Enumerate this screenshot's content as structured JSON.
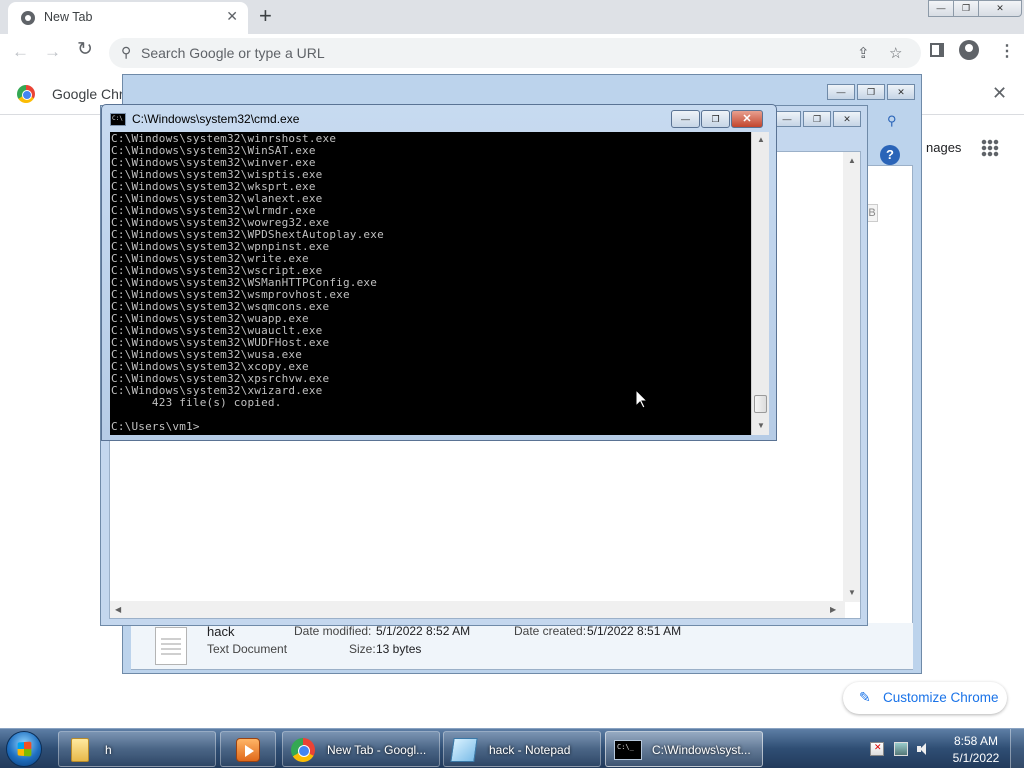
{
  "chrome": {
    "tab_title": "New Tab",
    "tab_close": "✕",
    "new_tab": "+",
    "omnibox_placeholder": "Search Google or type a URL",
    "back": "←",
    "forward": "→",
    "reload": "↻",
    "share": "⇪",
    "bookmark": "☆",
    "menu": "⋮",
    "infobar_text": "Google Chro",
    "infobar_close": "✕",
    "images_link": "nages",
    "customize_label": "Customize Chrome",
    "window_controls": {
      "minimize": "—",
      "maximize": "❐",
      "close": "✕"
    }
  },
  "explorer": {
    "file_name": "hack",
    "file_type": "Text Document",
    "date_modified_label": "Date modified:",
    "date_modified_value": "5/1/2022 8:52 AM",
    "date_created_label": "Date created:",
    "date_created_value": "5/1/2022 8:51 AM",
    "size_label": "Size:",
    "size_value": "13 bytes",
    "help": "?",
    "partial_label": "B"
  },
  "cmd": {
    "title": "C:\\Windows\\system32\\cmd.exe",
    "lines": [
      "C:\\Windows\\system32\\winrshost.exe",
      "C:\\Windows\\system32\\WinSAT.exe",
      "C:\\Windows\\system32\\winver.exe",
      "C:\\Windows\\system32\\wisptis.exe",
      "C:\\Windows\\system32\\wksprt.exe",
      "C:\\Windows\\system32\\wlanext.exe",
      "C:\\Windows\\system32\\wlrmdr.exe",
      "C:\\Windows\\system32\\wowreg32.exe",
      "C:\\Windows\\system32\\WPDShextAutoplay.exe",
      "C:\\Windows\\system32\\wpnpinst.exe",
      "C:\\Windows\\system32\\write.exe",
      "C:\\Windows\\system32\\wscript.exe",
      "C:\\Windows\\system32\\WSManHTTPConfig.exe",
      "C:\\Windows\\system32\\wsmprovhost.exe",
      "C:\\Windows\\system32\\wsqmcons.exe",
      "C:\\Windows\\system32\\wuapp.exe",
      "C:\\Windows\\system32\\wuauclt.exe",
      "C:\\Windows\\system32\\WUDFHost.exe",
      "C:\\Windows\\system32\\wusa.exe",
      "C:\\Windows\\system32\\xcopy.exe",
      "C:\\Windows\\system32\\xpsrchvw.exe",
      "C:\\Windows\\system32\\xwizard.exe",
      "      423 file(s) copied.",
      "",
      "C:\\Users\\vm1>"
    ]
  },
  "taskbar": {
    "items": [
      {
        "label": "h",
        "icon": "folder-icon"
      },
      {
        "label": "",
        "icon": "media-player-icon"
      },
      {
        "label": "New Tab - Googl...",
        "icon": "chrome-icon"
      },
      {
        "label": "hack - Notepad",
        "icon": "notepad-icon"
      },
      {
        "label": "C:\\Windows\\syst...",
        "icon": "cmd-icon"
      }
    ],
    "time": "8:58 AM",
    "date": "5/1/2022"
  }
}
